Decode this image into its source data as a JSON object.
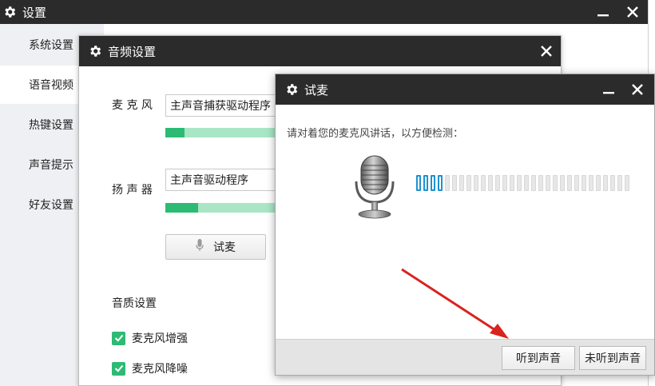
{
  "main_window": {
    "title": "设置",
    "sidebar": {
      "items": [
        {
          "label": "系统设置",
          "active": false
        },
        {
          "label": "语音视频",
          "active": true
        },
        {
          "label": "热键设置",
          "active": false
        },
        {
          "label": "声音提示",
          "active": false
        },
        {
          "label": "好友设置",
          "active": false
        }
      ]
    }
  },
  "audio_window": {
    "title": "音频设置",
    "microphone": {
      "label": "麦 克 风",
      "device": "主声音捕获驱动程序",
      "level_fraction": 0.16
    },
    "speaker": {
      "label": "扬 声 器",
      "device": "主声音驱动程序",
      "level_fraction": 0.27
    },
    "test_button_label": "试麦",
    "quality": {
      "heading": "音质设置",
      "options": [
        {
          "label": "麦克风增强",
          "checked": true
        },
        {
          "label": "麦克风降噪",
          "checked": true
        }
      ]
    }
  },
  "test_dialog": {
    "title": "试麦",
    "prompt": "请对着您的麦克风讲话，以方便检测：",
    "meter": {
      "active_segments": 4,
      "total_segments": 30
    },
    "buttons": {
      "heard": "听到声音",
      "not_heard": "未听到声音"
    }
  },
  "icons": {
    "settings": "gear-icon",
    "minimize": "minimize-icon",
    "close": "close-icon",
    "microphone": "microphone-icon",
    "checkbox": "checkmark-icon"
  },
  "colors": {
    "titlebar": "#2b2b2b",
    "sidebar_bg": "#eef0f3",
    "accent_green": "#2dbb74",
    "level_track": "#a8e6c6",
    "meter_active": "#1f92cf"
  }
}
